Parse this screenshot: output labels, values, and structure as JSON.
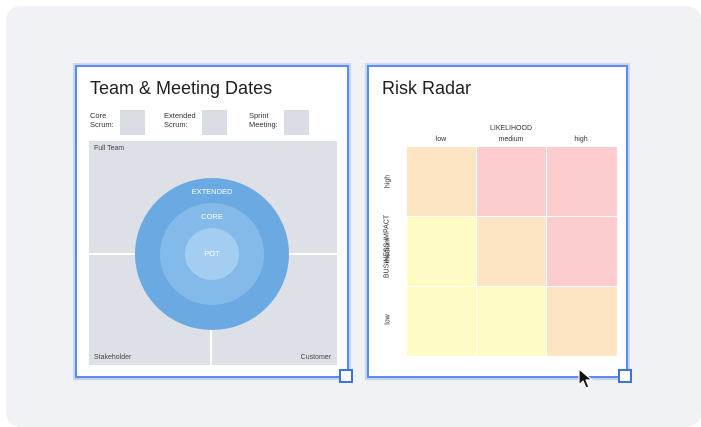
{
  "canvas": {
    "background": "#f1f2f5"
  },
  "team_card": {
    "title": "Team & Meeting Dates",
    "fields": [
      {
        "label": "Core\nScrum:"
      },
      {
        "label": "Extended\nScrum:"
      },
      {
        "label": "Sprint\nMeeting:"
      }
    ],
    "board": {
      "full_team_label": "Full Team",
      "stakeholder_label": "Stakeholder",
      "customer_label": "Customer",
      "rings": {
        "extended_label": "EXTENDED",
        "core_label": "CORE",
        "pot_label": "POT"
      },
      "colors": {
        "extended": "#6aa9e2",
        "core": "#84baea",
        "pot": "#a3cdf1",
        "board": "#dde1e7"
      }
    }
  },
  "risk_card": {
    "title": "Risk Radar",
    "likelihood_title": "LIKELIHOOD",
    "likelihood_levels": [
      "low",
      "medium",
      "high"
    ],
    "impact_title": "BUSINESS IMPACT",
    "impact_levels": [
      "high",
      "medium",
      "low"
    ],
    "matrix_colors": [
      [
        "#fde5c4",
        "#fccccf",
        "#fccccf"
      ],
      [
        "#fefbc4",
        "#fde5c4",
        "#fccccf"
      ],
      [
        "#fefbc4",
        "#fefbc4",
        "#fde5c4"
      ]
    ]
  },
  "accent_color": "#5b8cf2",
  "icons": {
    "resize_handle": "resize-handle-icon",
    "cursor": "mouse-pointer-icon"
  }
}
